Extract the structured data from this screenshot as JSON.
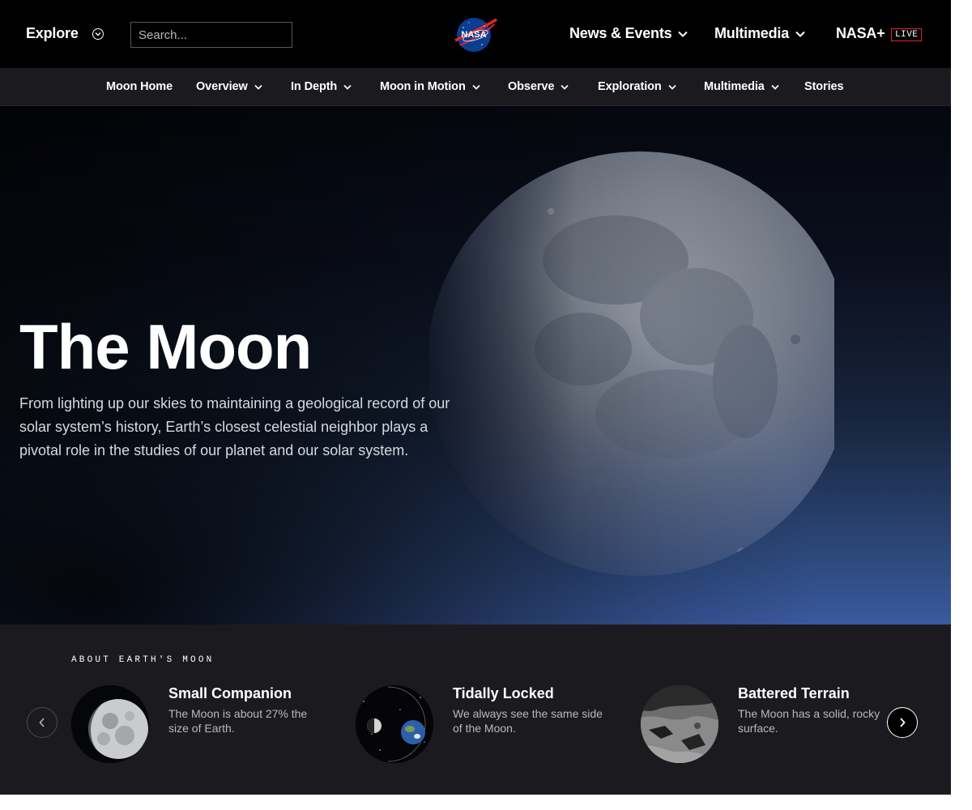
{
  "header": {
    "explore_label": "Explore",
    "search_placeholder": "Search...",
    "logo_text": "NASA",
    "nav": [
      {
        "label": "News & Events"
      },
      {
        "label": "Multimedia"
      },
      {
        "label": "NASA+"
      }
    ],
    "live_badge": "LIVE"
  },
  "subnav": {
    "items": [
      {
        "label": "Moon Home"
      },
      {
        "label": "Overview"
      },
      {
        "label": "In Depth"
      },
      {
        "label": "Moon in Motion"
      },
      {
        "label": "Observe"
      },
      {
        "label": "Exploration"
      },
      {
        "label": "Multimedia"
      },
      {
        "label": "Stories"
      }
    ]
  },
  "hero": {
    "title": "The Moon",
    "description": "From lighting up our skies to maintaining a geological record of our solar system’s history, Earth’s closest celestial neighbor plays a pivotal role in the studies of our planet and our solar system."
  },
  "about": {
    "eyebrow": "ABOUT EARTH'S MOON",
    "cards": [
      {
        "title": "Small Companion",
        "description": "The Moon is about 27% the size of Earth."
      },
      {
        "title": "Tidally Locked",
        "description": "We always see the same side of the Moon."
      },
      {
        "title": "Battered Terrain",
        "description": "The Moon has a solid, rocky surface."
      }
    ]
  },
  "colors": {
    "topbar": "#000000",
    "subnav": "#1b1b1f",
    "nasa_red": "#e0252d",
    "nasa_blue": "#0b3d91"
  },
  "icons": [
    "chevron-down-icon",
    "nasa-logo",
    "chevron-left-icon",
    "chevron-right-icon"
  ]
}
